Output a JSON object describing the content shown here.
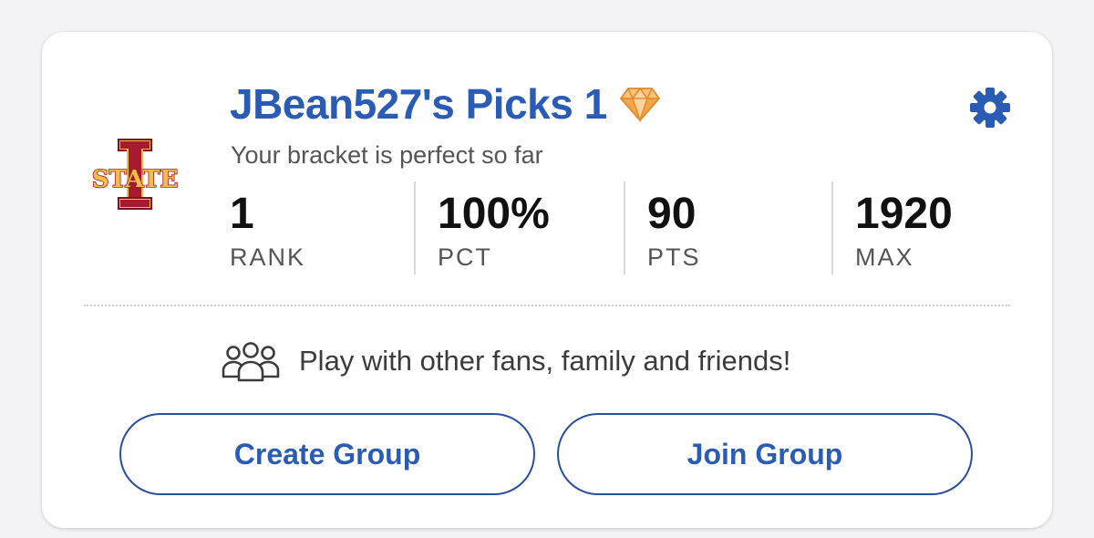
{
  "bracket": {
    "title": "JBean527's Picks 1",
    "badge_icon": "diamond-icon",
    "status": "Your bracket is perfect so far",
    "team_logo": "iowa-state-logo",
    "logo_text": "STATE",
    "settings_icon": "gear-icon"
  },
  "stats": [
    {
      "value": "1",
      "label": "RANK"
    },
    {
      "value": "100%",
      "label": "PCT"
    },
    {
      "value": "90",
      "label": "PTS"
    },
    {
      "value": "1920",
      "label": "MAX"
    }
  ],
  "groups": {
    "icon": "people-group-icon",
    "promo_text": "Play with other fans, family and friends!",
    "create_label": "Create Group",
    "join_label": "Join Group"
  },
  "colors": {
    "accent": "#2a5bb5",
    "logo_red": "#a6192e",
    "logo_gold": "#f1be48",
    "gem_orange": "#f5a54a"
  }
}
